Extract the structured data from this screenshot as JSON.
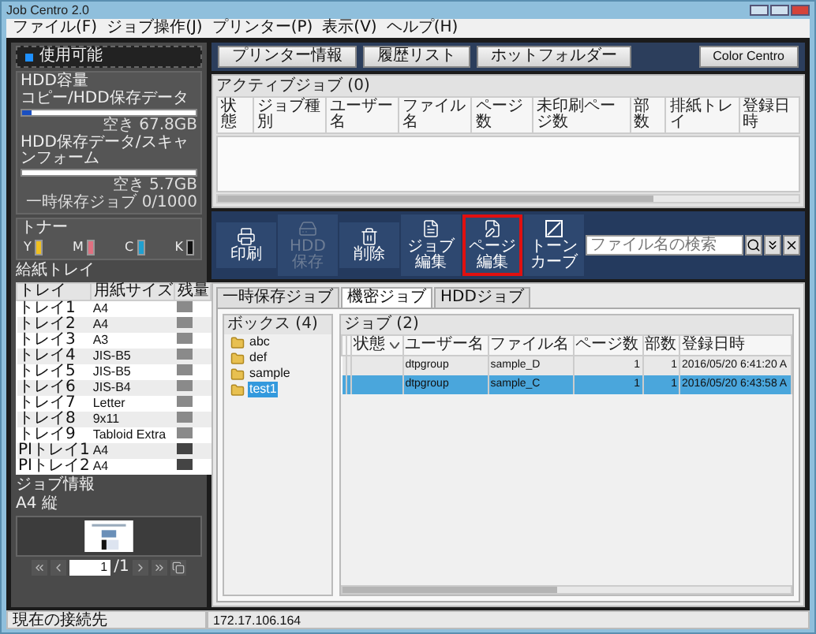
{
  "window": {
    "title": "Job Centro 2.0"
  },
  "menu": [
    "ファイル(F)",
    "ジョブ操作(J)",
    "プリンター(P)",
    "表示(V)",
    "ヘルプ(H)"
  ],
  "printer_status": {
    "label": "使用可能",
    "color": "#1e90ff"
  },
  "hdd": {
    "title": "HDD容量",
    "meters": [
      {
        "label": "コピー/HDD保存データ",
        "level": 0.05,
        "reading": "空き 67.8GB"
      },
      {
        "label": "HDD保存データ/スキャンフォーム",
        "reading": "空き 5.7GB"
      }
    ],
    "jobs": "一時保存ジョブ 0/1000"
  },
  "toner": {
    "title": "トナー",
    "items": [
      {
        "label": "Y",
        "color": "#f0c020"
      },
      {
        "label": "M",
        "color": "#e07080"
      },
      {
        "label": "C",
        "color": "#20a0d0"
      },
      {
        "label": "K",
        "color": "#111111"
      }
    ]
  },
  "trays": {
    "title": "給紙トレイ",
    "columns": [
      "トレイ",
      "用紙サイズ",
      "残量"
    ],
    "rows": [
      {
        "tray": "トレイ1",
        "size": "A4"
      },
      {
        "tray": "トレイ2",
        "size": "A4"
      },
      {
        "tray": "トレイ3",
        "size": "A3"
      },
      {
        "tray": "トレイ4",
        "size": "JIS-B5"
      },
      {
        "tray": "トレイ5",
        "size": "JIS-B5"
      },
      {
        "tray": "トレイ6",
        "size": "JIS-B4"
      },
      {
        "tray": "トレイ7",
        "size": "Letter"
      },
      {
        "tray": "トレイ8",
        "size": "9x11"
      },
      {
        "tray": "トレイ9",
        "size": "Tabloid Extra"
      },
      {
        "tray": "PIトレイ1",
        "size": "A4"
      },
      {
        "tray": "PIトレイ2",
        "size": "A4"
      }
    ]
  },
  "job_info": {
    "title": "ジョブ情報",
    "paper": "A4 縦",
    "page": "1",
    "total": "/1"
  },
  "top_buttons": [
    "プリンター情報",
    "履歴リスト",
    "ホットフォルダー"
  ],
  "color_centro": "Color Centro",
  "active_jobs": {
    "title": "アクティブジョブ (0)",
    "columns": [
      "状態",
      "ジョブ種別",
      "ユーザー名",
      "ファイル名",
      "ページ数",
      "未印刷ページ数",
      "部数",
      "排紙トレイ",
      "登録日時"
    ]
  },
  "toolbar": [
    {
      "label": "印刷",
      "kind": "print",
      "disabled": false,
      "selected": false
    },
    {
      "label": "HDD保存",
      "kind": "hdd",
      "disabled": true,
      "selected": false
    },
    {
      "label": "削除",
      "kind": "delete",
      "disabled": false,
      "selected": false
    },
    {
      "label": "ジョブ編集",
      "kind": "job",
      "disabled": false,
      "selected": false
    },
    {
      "label": "ページ編集",
      "kind": "page",
      "disabled": false,
      "selected": true
    },
    {
      "label": "トーンカーブ",
      "kind": "curve",
      "disabled": false,
      "selected": false
    }
  ],
  "search": {
    "placeholder": "ファイル名の検索"
  },
  "tabs": [
    {
      "label": "一時保存ジョブ",
      "selected": false
    },
    {
      "label": "機密ジョブ",
      "selected": true
    },
    {
      "label": "HDDジョブ",
      "selected": false
    }
  ],
  "boxes": {
    "title": "ボックス (4)",
    "items": [
      {
        "label": "abc",
        "selected": false
      },
      {
        "label": "def",
        "selected": false
      },
      {
        "label": "sample",
        "selected": false
      },
      {
        "label": "test1",
        "selected": true
      }
    ]
  },
  "jobs": {
    "title": "ジョブ (2)",
    "columns": [
      {
        "label": "状態",
        "sorted": true
      },
      {
        "label": "ユーザー名",
        "sorted": false
      },
      {
        "label": "ファイル名",
        "sorted": false
      },
      {
        "label": "ページ数",
        "sorted": false
      },
      {
        "label": "部数",
        "sorted": false
      },
      {
        "label": "登録日時",
        "sorted": false
      }
    ],
    "rows": [
      {
        "user": "dtpgroup",
        "file": "sample_D",
        "pages": "1",
        "copies": "1",
        "date": "2016/05/20 6:41:20 A",
        "selected": false
      },
      {
        "user": "dtpgroup",
        "file": "sample_C",
        "pages": "1",
        "copies": "1",
        "date": "2016/05/20 6:43:58 A",
        "selected": true
      }
    ]
  },
  "status_bar": [
    "現在の接続先",
    "172.17.106.164"
  ]
}
